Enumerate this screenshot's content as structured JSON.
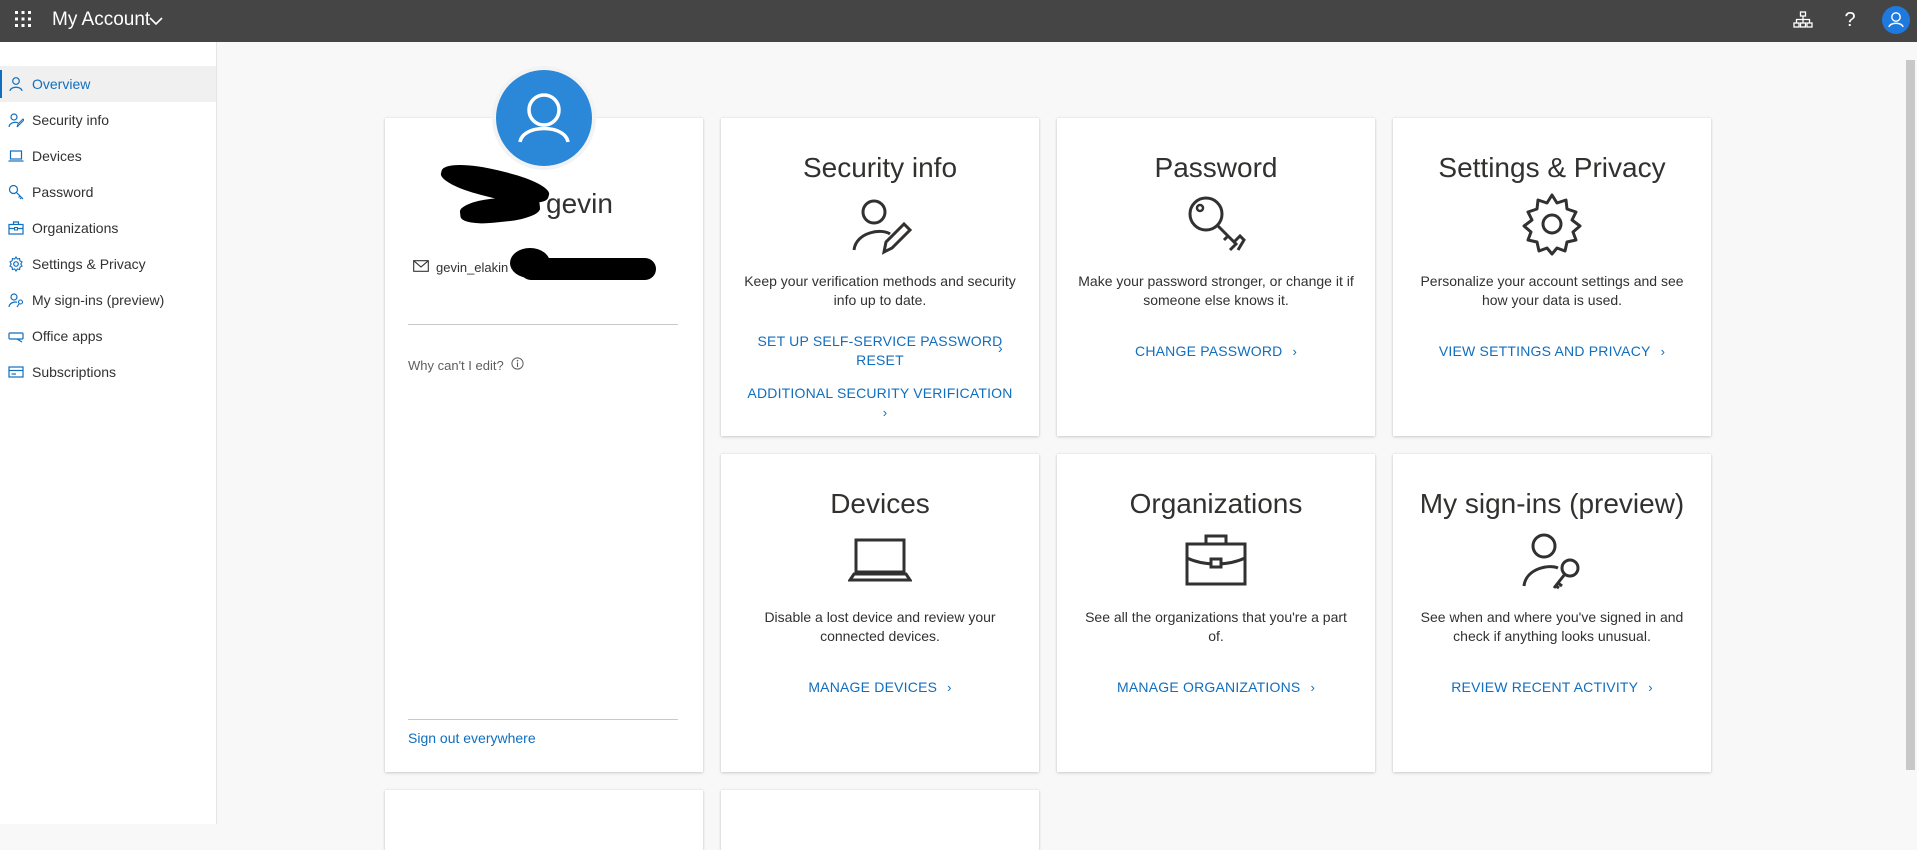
{
  "header": {
    "app_title": "My Account",
    "help_glyph": "?",
    "icons": [
      "waffle-icon",
      "chevron-down-icon",
      "org-chart-icon",
      "help-icon",
      "user-avatar-icon"
    ]
  },
  "sidebar": {
    "items": [
      {
        "label": "Overview",
        "icon": "person-icon"
      },
      {
        "label": "Security info",
        "icon": "security-person-icon"
      },
      {
        "label": "Devices",
        "icon": "laptop-icon"
      },
      {
        "label": "Password",
        "icon": "key-icon"
      },
      {
        "label": "Organizations",
        "icon": "briefcase-icon"
      },
      {
        "label": "Settings & Privacy",
        "icon": "gear-icon"
      },
      {
        "label": "My sign-ins (preview)",
        "icon": "person-key-icon"
      },
      {
        "label": "Office apps",
        "icon": "office-apps-icon"
      },
      {
        "label": "Subscriptions",
        "icon": "subscriptions-icon"
      }
    ],
    "active": "Overview"
  },
  "profile": {
    "name": "gevin",
    "email": "gevin_elakin",
    "why_edit": "Why can't I edit?",
    "sign_out": "Sign out everywhere"
  },
  "tiles": [
    {
      "title": "Security info",
      "icon": "security-person-icon",
      "desc": "Keep your verification methods and security info up to date.",
      "links": [
        "SET UP SELF-SERVICE PASSWORD RESET",
        "ADDITIONAL SECURITY VERIFICATION"
      ]
    },
    {
      "title": "Password",
      "icon": "key-icon",
      "desc": "Make your password stronger, or change it if someone else knows it.",
      "links": [
        "CHANGE PASSWORD"
      ]
    },
    {
      "title": "Settings & Privacy",
      "icon": "gear-icon",
      "desc": "Personalize your account settings and see how your data is used.",
      "links": [
        "VIEW SETTINGS AND PRIVACY"
      ]
    },
    {
      "title": "Devices",
      "icon": "laptop-icon",
      "desc": "Disable a lost device and review your connected devices.",
      "links": [
        "MANAGE DEVICES"
      ]
    },
    {
      "title": "Organizations",
      "icon": "briefcase-icon",
      "desc": "See all the organizations that you're a part of.",
      "links": [
        "MANAGE ORGANIZATIONS"
      ]
    },
    {
      "title": "My sign-ins (preview)",
      "icon": "person-key-icon",
      "desc": "See when and where you've signed in and check if anything looks unusual.",
      "links": [
        "REVIEW RECENT ACTIVITY"
      ]
    }
  ],
  "link_chevron": "›",
  "colors": {
    "topbar": "#454545",
    "accent": "#106ebe",
    "avatar": "#2b88d8"
  }
}
